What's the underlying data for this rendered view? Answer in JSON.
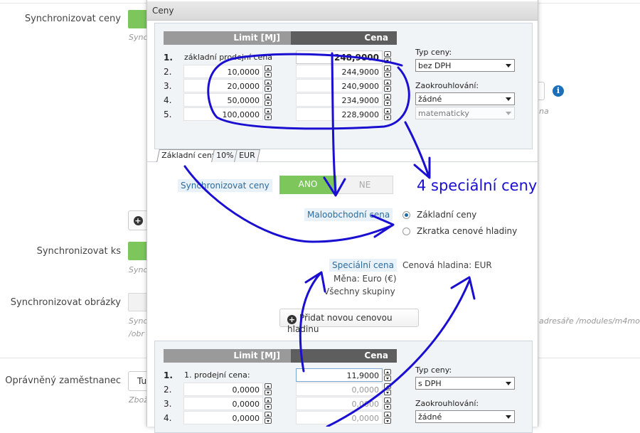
{
  "background": {
    "sync_prices_label": "Synchronizovat ceny",
    "sync_prices_hint": "Sync",
    "sync_qty_label": "Synchronizovat ks",
    "sync_qty_hint": "Sync",
    "sync_images_label": "Synchronizovat obrázky",
    "sync_images_hint_1": "Sync",
    "sync_images_hint_2": "/obr",
    "employee_label": "Oprávněný zaměstnanec",
    "employee_value": "Tu",
    "employee_hint": "Zbož",
    "right_fragment_1": "na",
    "right_fragment_2": "adresáře /modules/m4mo"
  },
  "panel": {
    "title": "Ceny",
    "grid_top": {
      "col_limit": "Limit [MJ]",
      "col_price": "Cena",
      "first_row": {
        "num": "1.",
        "label": "základní prodejní cena",
        "price": "248,9000"
      },
      "rows": [
        {
          "num": "2.",
          "limit": "10,0000",
          "price": "244,9000"
        },
        {
          "num": "3.",
          "limit": "20,0000",
          "price": "240,9000"
        },
        {
          "num": "4.",
          "limit": "50,0000",
          "price": "234,9000"
        },
        {
          "num": "5.",
          "limit": "100,0000",
          "price": "228,9000"
        }
      ],
      "price_type_label": "Typ ceny:",
      "price_type_value": "bez DPH",
      "rounding_label": "Zaokrouhlování:",
      "rounding_value": "žádné",
      "rounding_mode_value": "matematicky"
    },
    "tabs": [
      "Základní ceny",
      "10%",
      "EUR"
    ],
    "sync_prices_label": "Synchronizovat ceny",
    "toggle_yes": "ANO",
    "toggle_no": "NE",
    "retail_price_label": "Maloobchodní cena",
    "radio_basic": "Základní ceny",
    "radio_shortcut": "Zkratka cenové hladiny",
    "special_price_label": "Speciální cena",
    "price_level_text": "Cenová hladina: EUR",
    "currency_text": "Měna: Euro (€)",
    "groups_text": "Všechny skupiny",
    "add_level_button": "Přidat novou cenovou hladinu",
    "grid_bottom": {
      "col_limit": "Limit [MJ]",
      "col_price": "Cena",
      "first_row": {
        "num": "1.",
        "label": "1. prodejní cena:",
        "price": "11,9000"
      },
      "rows": [
        {
          "num": "2.",
          "limit": "0,0000",
          "price": "0,0000"
        },
        {
          "num": "3.",
          "limit": "0,0000",
          "price": "0,0000"
        },
        {
          "num": "4.",
          "limit": "0,0000",
          "price": "0,0000"
        }
      ],
      "price_type_label": "Typ ceny:",
      "price_type_value": "s DPH",
      "rounding_label": "Zaokrouhlování:",
      "rounding_value": "žádné"
    }
  },
  "annotation": {
    "text": "4 speciální ceny",
    "color": "#1a0fd1"
  },
  "colors": {
    "toggle_on": "#7cc65b",
    "header_limit": "#9a9a9a",
    "header_price": "#5e5e5e",
    "link_blue": "#2d6b9b"
  }
}
